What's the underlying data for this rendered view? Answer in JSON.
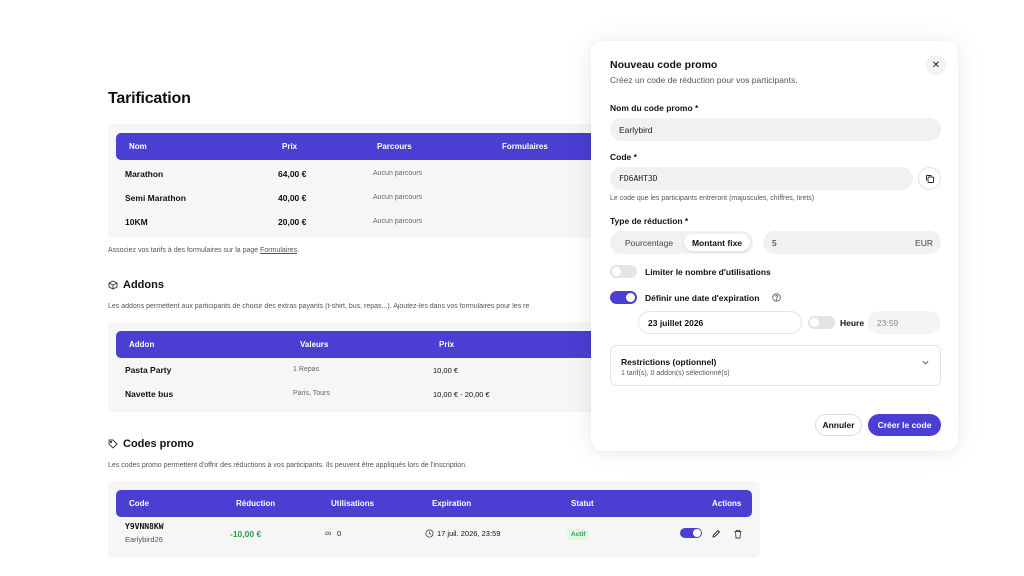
{
  "page": {
    "title": "Tarification"
  },
  "pricing": {
    "headers": [
      "Nom",
      "Prix",
      "Parcours",
      "Formulaires"
    ],
    "rows": [
      {
        "name": "Marathon",
        "price": "64,00 €",
        "courses": "Aucun parcours"
      },
      {
        "name": "Semi Marathon",
        "price": "40,00 €",
        "courses": "Aucun parcours"
      },
      {
        "name": "10KM",
        "price": "20,00 €",
        "courses": "Aucun parcours"
      }
    ],
    "note_prefix": "Associez vos tarifs à des formulaires sur la page ",
    "note_link": "Formulaires",
    "note_suffix": "."
  },
  "addons": {
    "title": "Addons",
    "description": "Les addons permettent aux participants de choisir des extras payants (t-shirt, bus, repas...). Ajoutez-les dans vos formulaires pour les re",
    "headers": [
      "Addon",
      "Valeurs",
      "Prix"
    ],
    "rows": [
      {
        "name": "Pasta Party",
        "values": "1 Repas",
        "price": "10,00 €"
      },
      {
        "name": "Navette bus",
        "values": "Paris, Tours",
        "price": "10,00 € - 20,00 €"
      }
    ]
  },
  "promo": {
    "title": "Codes promo",
    "description": "Les codes promo permettent d'offrir des réductions à vos participants. Ils peuvent être appliqués lors de l'inscription.",
    "headers": [
      "Code",
      "Réduction",
      "Utilisations",
      "Expiration",
      "Statut",
      "Actions"
    ],
    "rows": [
      {
        "code": "Y9VNN8KW",
        "name": "Earlybird26",
        "reduction": "-10,00 €",
        "uses_symbol": "∞",
        "uses": "0",
        "expiration": "17 juil. 2026, 23:59",
        "status": "Actif"
      }
    ]
  },
  "modal": {
    "title": "Nouveau code promo",
    "subtitle": "Créez un code de réduction pour vos participants.",
    "name_label": "Nom du code promo *",
    "name_value": "Earlybird",
    "code_label": "Code *",
    "code_value": "FD6AHT3D",
    "code_help": "Le code que les participants entreront (majuscules, chiffres, tirets)",
    "type_label": "Type de réduction *",
    "type_options": [
      "Pourcentage",
      "Montant fixe"
    ],
    "amount_value": "5",
    "amount_unit": "EUR",
    "limit_label": "Limiter le nombre d'utilisations",
    "expiry_label": "Définir une date d'expiration",
    "date_value": "23 juillet 2026",
    "time_label": "Heure",
    "time_value": "23:59",
    "restrictions_title": "Restrictions (optionnel)",
    "restrictions_sub": "1 tarif(s), 0 addon(s) sélectionné(s)",
    "cancel_label": "Annuler",
    "create_label": "Créer le code"
  },
  "colors": {
    "accent": "#4a3ed3",
    "success": "#2e9a4a",
    "card_bg": "#f6f6f7"
  }
}
